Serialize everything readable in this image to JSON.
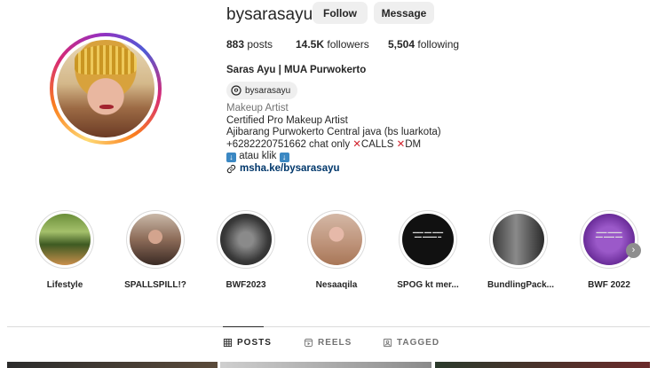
{
  "profile": {
    "username": "bysarasayu",
    "follow_label": "Follow",
    "message_label": "Message",
    "stats": {
      "posts_count": "883",
      "posts_label": "posts",
      "followers_count": "14.5K",
      "followers_label": "followers",
      "following_count": "5,504",
      "following_label": "following"
    },
    "full_name": "Saras Ayu | MUA Purwokerto",
    "threads_handle": "bysarasayu",
    "category": "Makeup Artist",
    "bio": {
      "line1": "Certified Pro Makeup Artist",
      "line2": "Ajibarang Purwokerto Central java (bs luarkota)",
      "line3_prefix": "+6282220751662 chat only ",
      "line3_calls": "CALLS",
      "line3_dm": "DM",
      "line4_text": " atau klik ",
      "link": "msha.ke/bysarasayu"
    }
  },
  "highlights": [
    {
      "label": "Lifestyle"
    },
    {
      "label": "SPALLSPILL!?"
    },
    {
      "label": "BWF2023"
    },
    {
      "label": "Nesaaqila"
    },
    {
      "label": "SPOG kt mer..."
    },
    {
      "label": "BundlingPack..."
    },
    {
      "label": "BWF 2022"
    }
  ],
  "tabs": {
    "posts": "POSTS",
    "reels": "REELS",
    "tagged": "TAGGED"
  },
  "colors": {
    "accent_link": "#00376b",
    "button_bg": "#efefef",
    "x_mark": "#d0202a",
    "arrow_box": "#3b88c3"
  },
  "icons": {
    "threads": "threads-icon",
    "link": "link-icon",
    "posts": "grid-icon",
    "reels": "reels-icon",
    "tagged": "tagged-icon",
    "next": "chevron-right-icon"
  }
}
